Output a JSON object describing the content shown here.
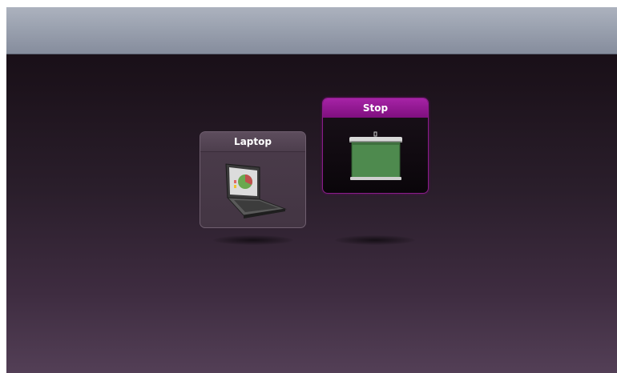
{
  "sources": [
    {
      "label": "Laptop",
      "icon": "laptop-icon",
      "state": "inactive"
    },
    {
      "label": "Stop",
      "icon": "projection-screen-icon",
      "state": "active"
    }
  ],
  "colors": {
    "active_header": "#9b1e9b",
    "inactive_header": "#564656",
    "top_bar": "#9aa1af",
    "background_dark": "#140c13",
    "background_light": "#533f56"
  }
}
